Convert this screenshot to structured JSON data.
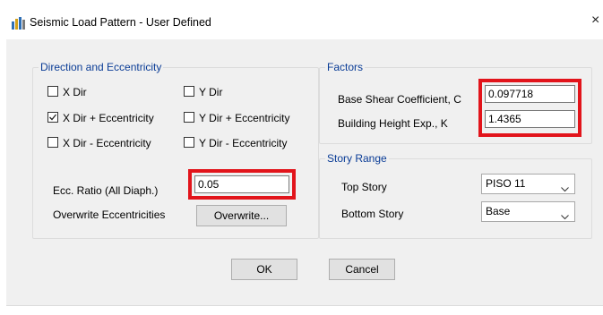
{
  "window": {
    "title": "Seismic Load Pattern - User Defined",
    "close_glyph": "×"
  },
  "direction_group": {
    "label": "Direction and Eccentricity",
    "checkboxes": [
      {
        "label": "X Dir",
        "checked": false
      },
      {
        "label": "Y Dir",
        "checked": false
      },
      {
        "label": "X Dir + Eccentricity",
        "checked": true
      },
      {
        "label": "Y Dir + Eccentricity",
        "checked": false
      },
      {
        "label": "X Dir - Eccentricity",
        "checked": false
      },
      {
        "label": "Y Dir - Eccentricity",
        "checked": false
      }
    ],
    "ecc_ratio_label": "Ecc. Ratio (All Diaph.)",
    "ecc_ratio_value": "0.05",
    "overwrite_label": "Overwrite Eccentricities",
    "overwrite_button": "Overwrite..."
  },
  "factors_group": {
    "label": "Factors",
    "base_shear_label": "Base Shear Coefficient, C",
    "base_shear_value": "0.097718",
    "height_exp_label": "Building Height Exp., K",
    "height_exp_value": "1.4365"
  },
  "story_range_group": {
    "label": "Story Range",
    "top_story_label": "Top Story",
    "top_story_value": "PISO 11",
    "bottom_story_label": "Bottom Story",
    "bottom_story_value": "Base"
  },
  "buttons": {
    "ok": "OK",
    "cancel": "Cancel"
  },
  "colors": {
    "highlight": "#e2141b",
    "group_label": "#0a3c96",
    "dialog_bg": "#f0f0f0"
  }
}
